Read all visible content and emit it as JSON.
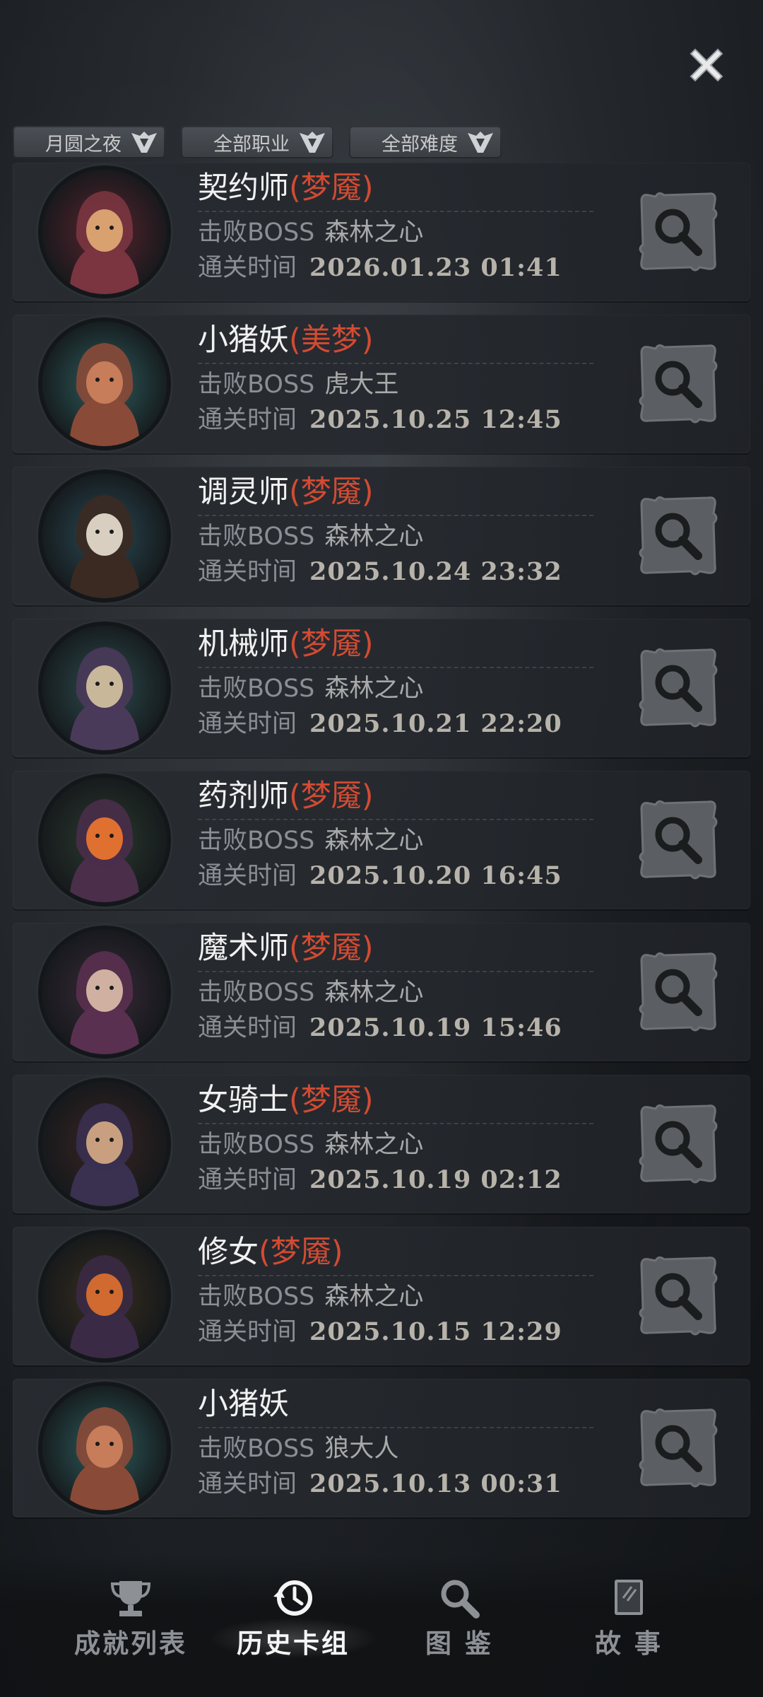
{
  "filters": [
    {
      "label": "月圆之夜"
    },
    {
      "label": "全部职业"
    },
    {
      "label": "全部难度"
    }
  ],
  "records": [
    {
      "name": "契约师",
      "difficulty": "(梦魇)",
      "boss_label": "击败BOSS",
      "boss": "森林之心",
      "time_label": "通关时间",
      "time": "2026.01.23 01:41",
      "portrait": "hooded-red-girl"
    },
    {
      "name": "小猪妖",
      "difficulty": "(美梦)",
      "boss_label": "击败BOSS",
      "boss": "虎大王",
      "time_label": "通关时间",
      "time": "2025.10.25 12:45",
      "portrait": "boar"
    },
    {
      "name": "调灵师",
      "difficulty": "(梦魇)",
      "boss_label": "击败BOSS",
      "boss": "森林之心",
      "time_label": "通关时间",
      "time": "2025.10.24 23:32",
      "portrait": "antler-witch"
    },
    {
      "name": "机械师",
      "difficulty": "(梦魇)",
      "boss_label": "击败BOSS",
      "boss": "森林之心",
      "time_label": "通关时间",
      "time": "2025.10.21 22:20",
      "portrait": "mechanic"
    },
    {
      "name": "药剂师",
      "difficulty": "(梦魇)",
      "boss_label": "击败BOSS",
      "boss": "森林之心",
      "time_label": "通关时间",
      "time": "2025.10.20 16:45",
      "portrait": "alchemist"
    },
    {
      "name": "魔术师",
      "difficulty": "(梦魇)",
      "boss_label": "击败BOSS",
      "boss": "森林之心",
      "time_label": "通关时间",
      "time": "2025.10.19 15:46",
      "portrait": "magician"
    },
    {
      "name": "女骑士",
      "difficulty": "(梦魇)",
      "boss_label": "击败BOSS",
      "boss": "森林之心",
      "time_label": "通关时间",
      "time": "2025.10.19 02:12",
      "portrait": "knight"
    },
    {
      "name": "修女",
      "difficulty": "(梦魇)",
      "boss_label": "击败BOSS",
      "boss": "森林之心",
      "time_label": "通关时间",
      "time": "2025.10.15 12:29",
      "portrait": "nun"
    },
    {
      "name": "小猪妖",
      "difficulty": "",
      "boss_label": "击败BOSS",
      "boss": "狼大人",
      "time_label": "通关时间",
      "time": "2025.10.13 00:31",
      "portrait": "boar"
    }
  ],
  "nav": [
    {
      "label": "成就列表",
      "icon": "trophy-icon",
      "active": false
    },
    {
      "label": "历史卡组",
      "icon": "history-icon",
      "active": true
    },
    {
      "label": "图 鉴",
      "icon": "magnifier-icon",
      "active": false
    },
    {
      "label": "故 事",
      "icon": "book-icon",
      "active": false
    }
  ],
  "colors": {
    "difficulty": "#d24b32",
    "text": "#f1f1f1",
    "muted": "#8a8f95"
  }
}
